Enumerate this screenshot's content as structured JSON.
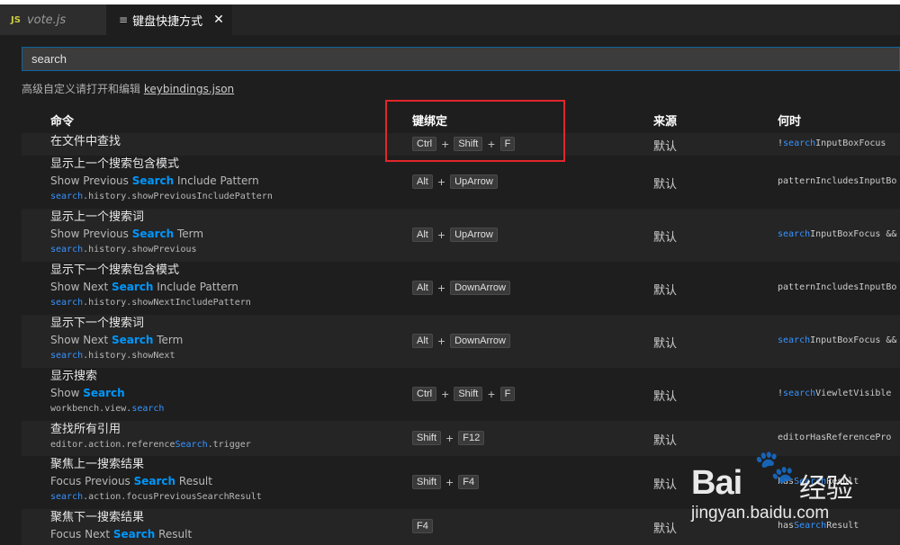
{
  "tabs": [
    {
      "icon": "JS",
      "label": "vote.js"
    },
    {
      "icon": "≡",
      "label": "键盘快捷方式",
      "close": "✕"
    }
  ],
  "search": {
    "value": "search"
  },
  "advanced": {
    "text": "高级自定义请打开和编辑 ",
    "link": "keybindings.json"
  },
  "columns": {
    "command": "命令",
    "keybinding": "键绑定",
    "source": "来源",
    "when": "何时"
  },
  "rows": [
    {
      "title": "在文件中查找",
      "desc": [
        "",
        "",
        ""
      ],
      "id": [
        "",
        "",
        ""
      ],
      "keys": [
        "Ctrl",
        "Shift",
        "F"
      ],
      "source": "默认",
      "when": [
        "!",
        "search",
        "InputBoxFocus"
      ]
    },
    {
      "title": "显示上一个搜索包含模式",
      "desc": [
        "Show Previous ",
        "Search",
        " Include Pattern"
      ],
      "id": [
        "",
        "search",
        ".history.showPreviousIncludePattern"
      ],
      "keys": [
        "Alt",
        "UpArrow"
      ],
      "source": "默认",
      "when": [
        "",
        "",
        "patternIncludesInputBo"
      ]
    },
    {
      "title": "显示上一个搜索词",
      "desc": [
        "Show Previous ",
        "Search",
        " Term"
      ],
      "id": [
        "",
        "search",
        ".history.showPrevious"
      ],
      "keys": [
        "Alt",
        "UpArrow"
      ],
      "source": "默认",
      "when": [
        "",
        "search",
        "InputBoxFocus &&"
      ]
    },
    {
      "title": "显示下一个搜索包含模式",
      "desc": [
        "Show Next ",
        "Search",
        " Include Pattern"
      ],
      "id": [
        "",
        "search",
        ".history.showNextIncludePattern"
      ],
      "keys": [
        "Alt",
        "DownArrow"
      ],
      "source": "默认",
      "when": [
        "",
        "",
        "patternIncludesInputBo"
      ]
    },
    {
      "title": "显示下一个搜索词",
      "desc": [
        "Show Next ",
        "Search",
        " Term"
      ],
      "id": [
        "",
        "search",
        ".history.showNext"
      ],
      "keys": [
        "Alt",
        "DownArrow"
      ],
      "source": "默认",
      "when": [
        "",
        "search",
        "InputBoxFocus &&"
      ]
    },
    {
      "title": "显示搜索",
      "desc": [
        "Show ",
        "Search",
        ""
      ],
      "id": [
        "workbench.view.",
        "search",
        ""
      ],
      "keys": [
        "Ctrl",
        "Shift",
        "F"
      ],
      "source": "默认",
      "when": [
        "!",
        "search",
        "ViewletVisible"
      ]
    },
    {
      "title": "查找所有引用",
      "desc": [
        "",
        "",
        ""
      ],
      "id": [
        "editor.action.reference",
        "Search",
        ".trigger"
      ],
      "keys": [
        "Shift",
        "F12"
      ],
      "source": "默认",
      "when": [
        "",
        "",
        "editorHasReferencePro"
      ]
    },
    {
      "title": "聚焦上一搜索结果",
      "desc": [
        "Focus Previous ",
        "Search",
        " Result"
      ],
      "id": [
        "",
        "search",
        ".action.focusPreviousSearchResult"
      ],
      "keys": [
        "Shift",
        "F4"
      ],
      "source": "默认",
      "when": [
        "has",
        "Search",
        "Result"
      ]
    },
    {
      "title": "聚焦下一搜索结果",
      "desc": [
        "Focus Next ",
        "Search",
        " Result"
      ],
      "id": [
        "",
        "",
        ""
      ],
      "keys": [
        "F4"
      ],
      "source": "默认",
      "when": [
        "has",
        "Search",
        "Result"
      ]
    }
  ],
  "watermark": {
    "brand": "Bai",
    "brand2": "经验",
    "url": "jingyan.baidu.com"
  },
  "colors": {
    "accent": "#0097fb",
    "highlight_box": "#e3262b",
    "background": "#1e1e1e"
  }
}
